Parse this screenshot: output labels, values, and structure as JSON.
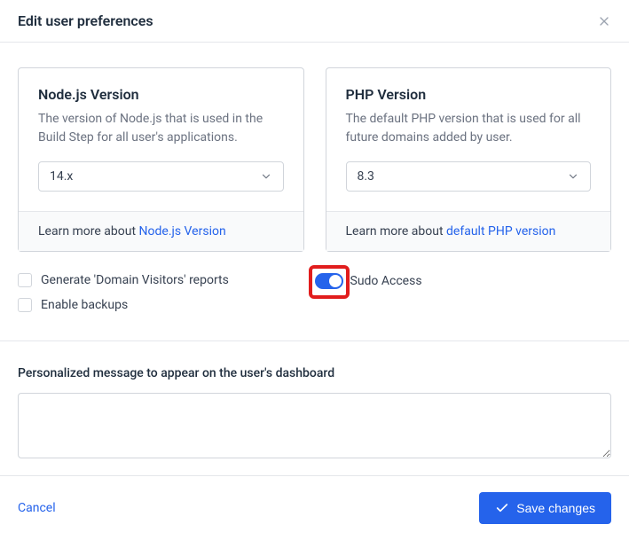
{
  "header": {
    "title": "Edit user preferences"
  },
  "cards": {
    "node": {
      "title": "Node.js Version",
      "description": "The version of Node.js that is used in the Build Step for all user's applications.",
      "value": "14.x",
      "learn_prefix": "Learn more about ",
      "learn_link": "Node.js Version"
    },
    "php": {
      "title": "PHP Version",
      "description": "The default PHP version that is used for all future domains added by user.",
      "value": "8.3",
      "learn_prefix": "Learn more about ",
      "learn_link": "default PHP version"
    }
  },
  "options": {
    "domain_reports": "Generate 'Domain Visitors' reports",
    "enable_backups": "Enable backups",
    "sudo_access": "Sudo Access"
  },
  "textarea": {
    "label": "Personalized message to appear on the user's dashboard",
    "value": ""
  },
  "footer": {
    "cancel": "Cancel",
    "save": "Save changes"
  }
}
